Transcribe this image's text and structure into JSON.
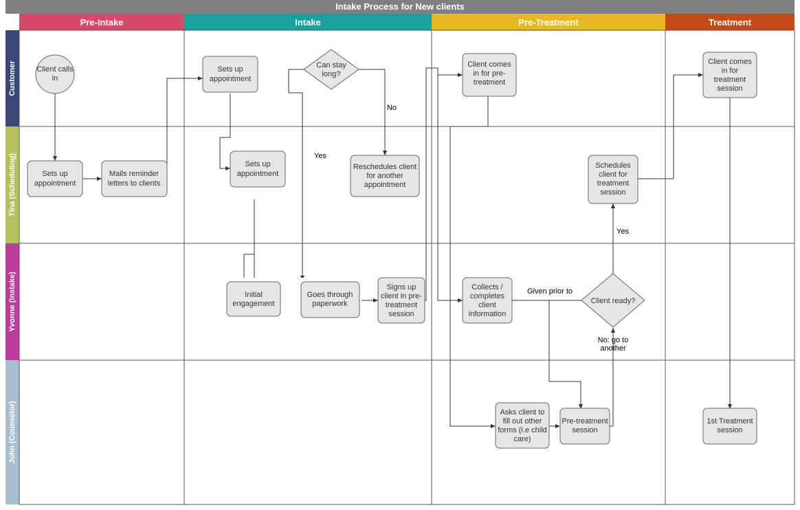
{
  "title": "Intake Process for New clients",
  "phases": [
    {
      "id": "pre-intake",
      "label": "Pre-Intake",
      "color": "#d6496a"
    },
    {
      "id": "intake",
      "label": "Intake",
      "color": "#1aa19c"
    },
    {
      "id": "pre-treatment",
      "label": "Pre-Treatment",
      "color": "#e8b820"
    },
    {
      "id": "treatment",
      "label": "Treatment",
      "color": "#c54a19"
    }
  ],
  "lanes": [
    {
      "id": "customer",
      "label": "Customer",
      "color": "#3a4877"
    },
    {
      "id": "tina",
      "label": "Tina (Scheduling)",
      "color": "#b7c05f"
    },
    {
      "id": "yvonne",
      "label": "Yvonne (Instake)",
      "color": "#b93d9a"
    },
    {
      "id": "john",
      "label": "John (Counselor)",
      "color": "#a7bfcf"
    }
  ],
  "nodes": {
    "n1": {
      "lines": [
        "Client calls",
        "in"
      ]
    },
    "n2": {
      "lines": [
        "Sets up",
        "appointment"
      ]
    },
    "n3": {
      "lines": [
        "Mails reminder",
        "letters to clients"
      ]
    },
    "n4": {
      "lines": [
        "Sets up",
        "appointment"
      ]
    },
    "n5": {
      "lines": [
        "Can stay",
        "long?"
      ]
    },
    "n6": {
      "lines": [
        "Sets up",
        "appointment"
      ]
    },
    "n7": {
      "lines": [
        "Reschedules client",
        "for another",
        "appointment"
      ]
    },
    "n8": {
      "lines": [
        "Initial",
        "engagement"
      ]
    },
    "n9": {
      "lines": [
        "Goes through",
        "paperwork"
      ]
    },
    "n10": {
      "lines": [
        "Signs up",
        "client in pre-",
        "treatment",
        "session"
      ]
    },
    "n11": {
      "lines": [
        "Client comes",
        "in for pre-",
        "treatment"
      ]
    },
    "n12": {
      "lines": [
        "Collects /",
        "completes",
        "client",
        "information"
      ]
    },
    "n13": {
      "lines": [
        "Client ready?"
      ]
    },
    "n14": {
      "lines": [
        "Schedules",
        "client for",
        "treatment",
        "session"
      ]
    },
    "n15": {
      "lines": [
        "Asks client to",
        "fill out other",
        "forms (i.e child",
        "care)"
      ]
    },
    "n16": {
      "lines": [
        "Pre-treatment",
        "session"
      ]
    },
    "n17": {
      "lines": [
        "Client comes",
        "in for",
        "treatment",
        "session"
      ]
    },
    "n18": {
      "lines": [
        "1st Treatment",
        "session"
      ]
    }
  },
  "edgeLabels": {
    "no": "No",
    "yes": "Yes",
    "yes2": "Yes",
    "given": "Given prior to",
    "nogo": "No: go to\nanother"
  }
}
